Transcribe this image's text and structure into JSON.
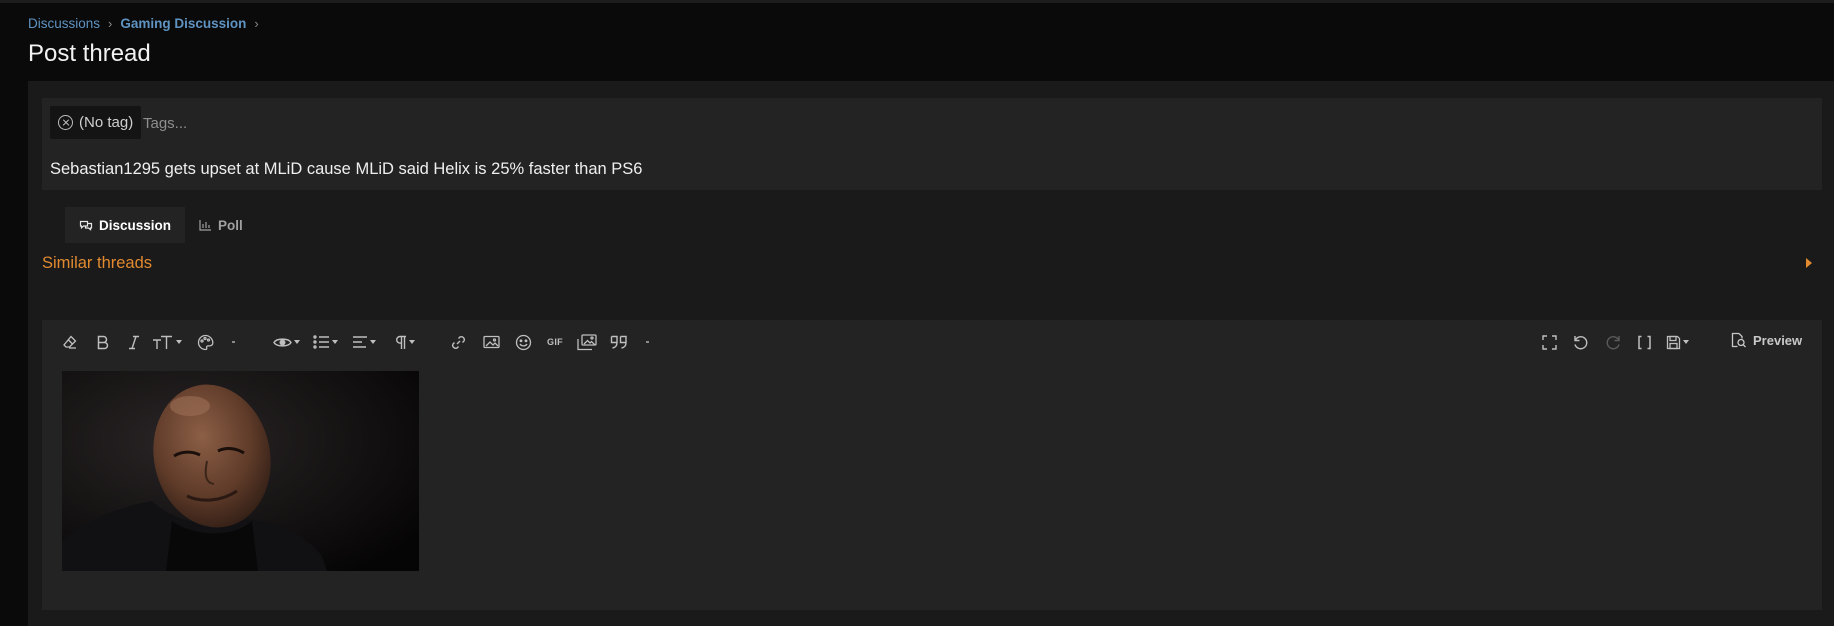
{
  "breadcrumb": {
    "items": [
      {
        "label": "Discussions"
      },
      {
        "label": "Gaming Discussion"
      }
    ],
    "separator": "›"
  },
  "page": {
    "title": "Post thread"
  },
  "thread": {
    "prefix": "(No tag)",
    "tags_placeholder": "Tags...",
    "title": "Sebastian1295 gets upset at MLiD cause MLiD said Helix is 25% faster than PS6"
  },
  "tabs": [
    {
      "label": "Discussion",
      "icon": "comments-icon",
      "active": true
    },
    {
      "label": "Poll",
      "icon": "bar-chart-icon",
      "active": false
    }
  ],
  "similar_threads": {
    "label": "Similar threads"
  },
  "editor": {
    "toolbar_left": [
      "remove-format-icon",
      "bold-icon",
      "italic-icon",
      "font-size-icon",
      "text-color-icon",
      "more-options-icon",
      "view-icon",
      "list-icon",
      "align-icon",
      "paragraph-icon",
      "link-icon",
      "insert-image-icon",
      "emoji-icon",
      "gif-icon",
      "media-icon",
      "quote-icon",
      "more-options-icon"
    ],
    "toolbar_right": [
      "fullscreen-icon",
      "undo-icon",
      "redo-icon",
      "bbcode-toggle-icon",
      "drafts-icon"
    ],
    "gif_label": "GIF",
    "preview_label": "Preview",
    "content_image": "gif-image"
  },
  "colors": {
    "background": "#0a0a0a",
    "panel": "#1a1a1a",
    "input": "#232323",
    "link": "#5f93c2",
    "accent": "#e28a2f"
  }
}
